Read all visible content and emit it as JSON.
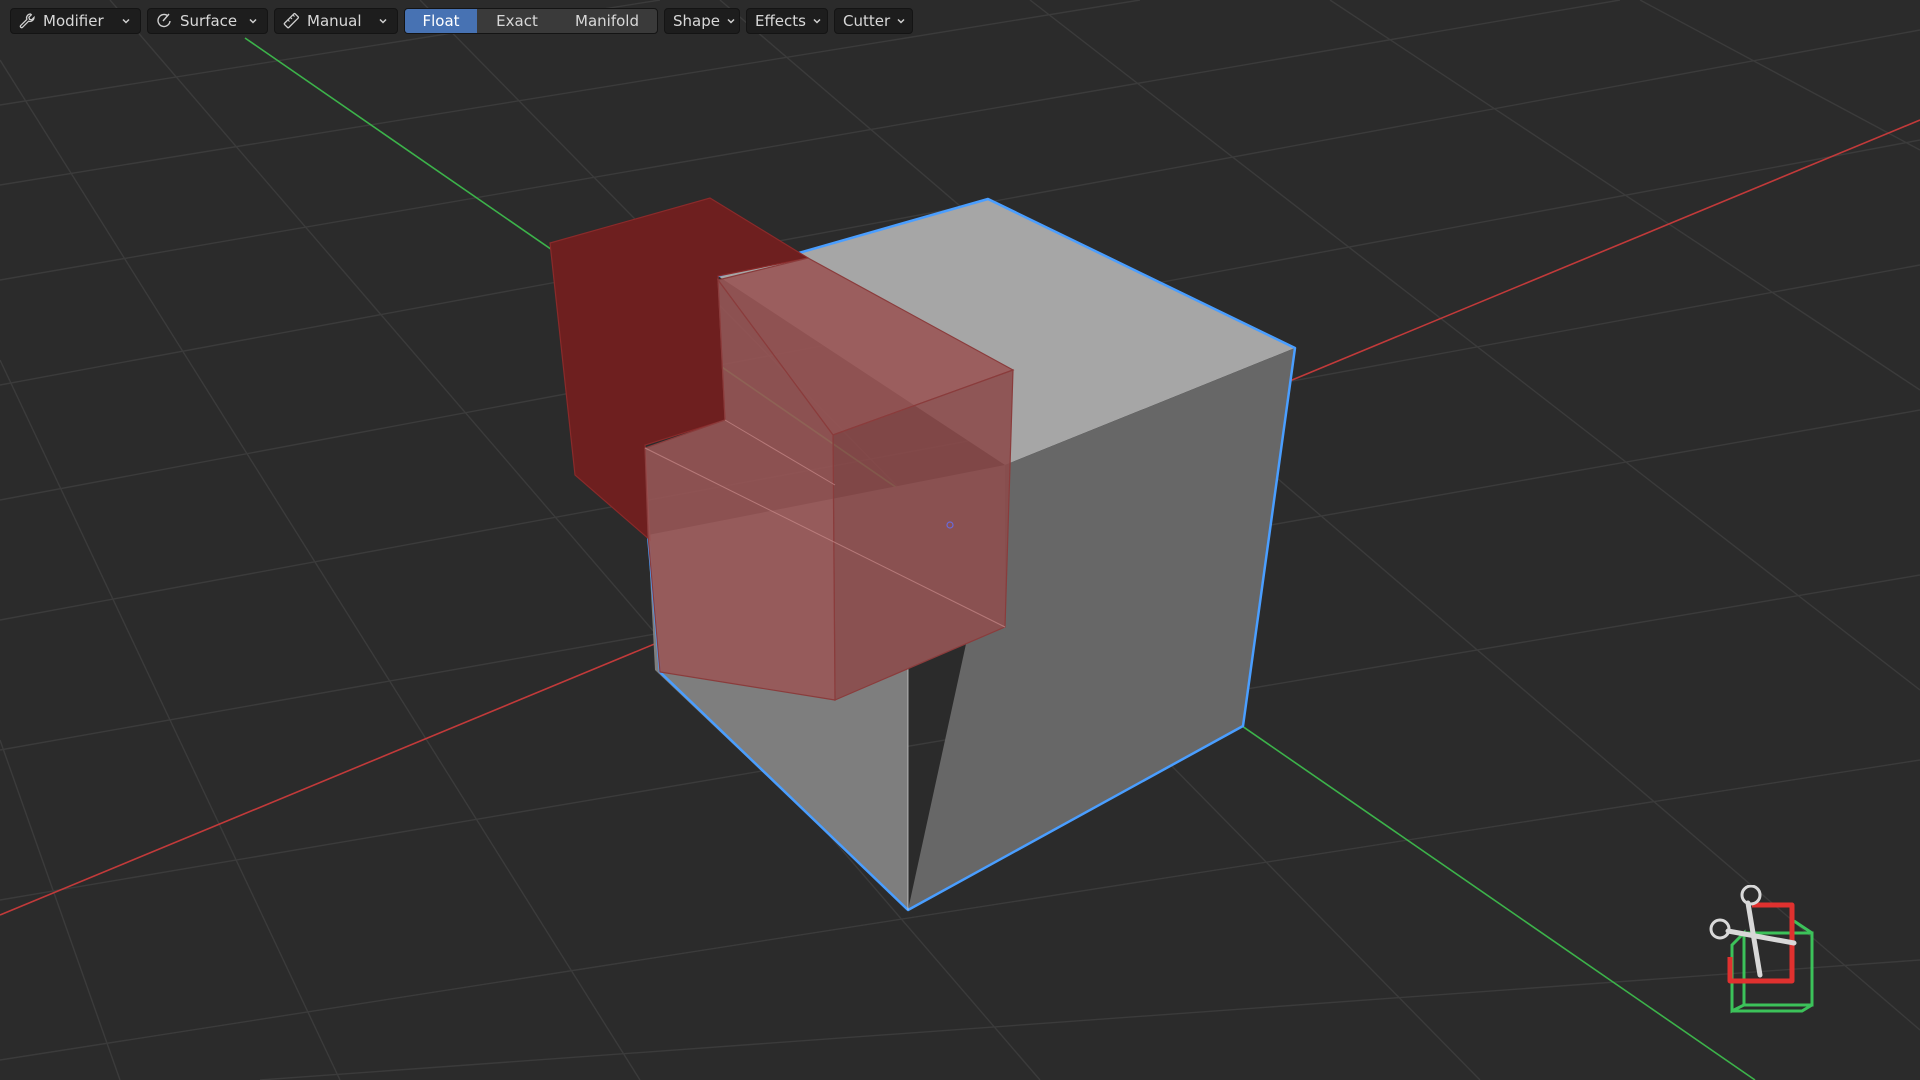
{
  "toolbar": {
    "modifier_label": "Modifier",
    "surface_label": "Surface",
    "manual_label": "Manual",
    "modes": [
      "Float",
      "Exact",
      "Manifold"
    ],
    "active_mode": "Float",
    "shape_label": "Shape",
    "effects_label": "Effects",
    "cutter_label": "Cutter"
  },
  "icons": {
    "modifier": "wrench-icon",
    "surface": "surface-icon",
    "manual": "ruler-icon",
    "gizmo": "scissors-boolean-cut-icon"
  },
  "colors": {
    "background": "#2b2b2b",
    "grid": "#3a3a3a",
    "x_axis": "#c23a3a",
    "y_axis": "#3cb34a",
    "selection_outline": "#4a9eff",
    "cube_top": "#a6a6a6",
    "cube_side": "#6b6b6b",
    "cutter_volume": "#8a2a2a",
    "active_button": "#4772b3"
  }
}
